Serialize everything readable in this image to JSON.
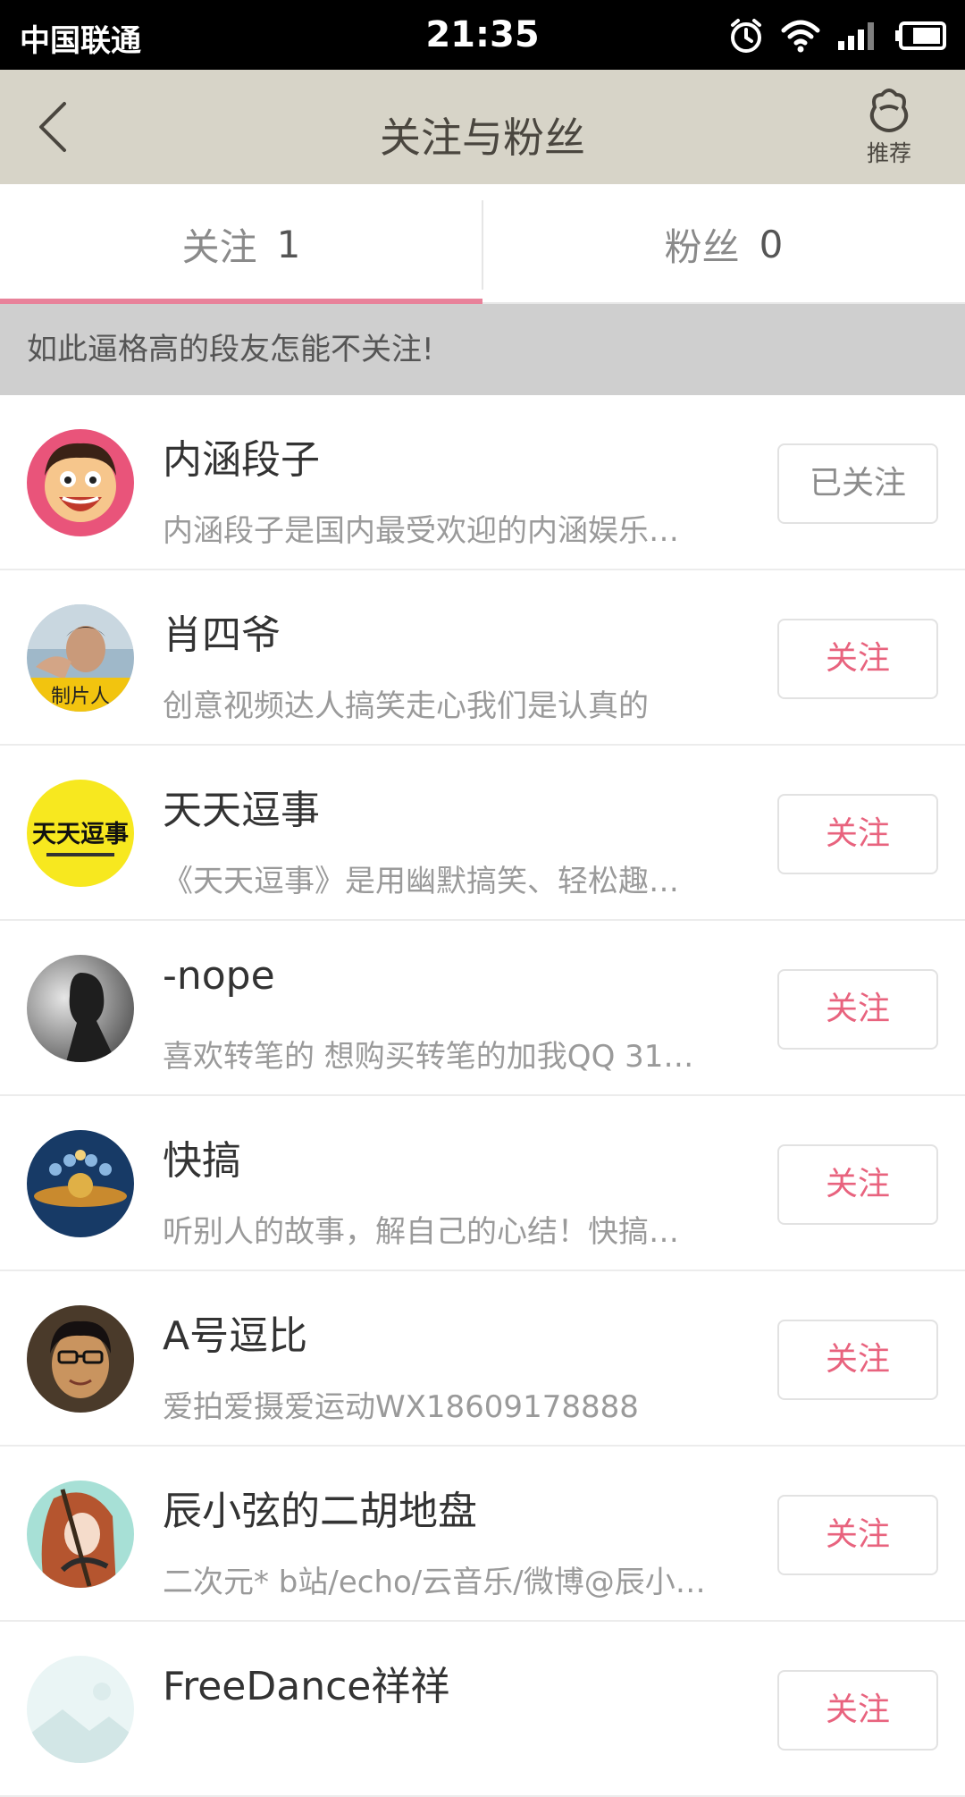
{
  "status_bar": {
    "carrier": "中国联通",
    "time": "21:35"
  },
  "header": {
    "title": "关注与粉丝",
    "recommend_label": "推荐"
  },
  "tabs": [
    {
      "label": "关注",
      "count": "1",
      "active": true
    },
    {
      "label": "粉丝",
      "count": "0",
      "active": false
    }
  ],
  "banner": "如此逼格高的段友怎能不关注!",
  "users": [
    {
      "name": "内涵段子",
      "desc": "内涵段子是国内最受欢迎的内涵娱乐…",
      "button": "已关注",
      "followed": true,
      "avatar": "cartoon-face"
    },
    {
      "name": "肖四爷",
      "desc": "创意视频达人搞笑走心我们是认真的",
      "button": "关注",
      "followed": false,
      "avatar": "person-photo",
      "avatar_badge": "制片人"
    },
    {
      "name": "天天逗事",
      "desc": "《天天逗事》是用幽默搞笑、轻松趣…",
      "button": "关注",
      "followed": false,
      "avatar": "yellow-logo",
      "avatar_text": "天天逗事"
    },
    {
      "name": "-nope",
      "desc": "喜欢转笔的 想购买转笔的加我QQ 31…",
      "button": "关注",
      "followed": false,
      "avatar": "silhouette"
    },
    {
      "name": "快搞",
      "desc": "听别人的故事，解自己的心结！快搞…",
      "button": "关注",
      "followed": false,
      "avatar": "blue-emblem"
    },
    {
      "name": "A号逗比",
      "desc": "爱拍爱摄爱运动WX18609178888",
      "button": "关注",
      "followed": false,
      "avatar": "glasses-photo"
    },
    {
      "name": "辰小弦的二胡地盘",
      "desc": "二次元* b站/echo/云音乐/微博@辰小…",
      "button": "关注",
      "followed": false,
      "avatar": "anime-art"
    },
    {
      "name": "FreeDance祥祥",
      "desc": "",
      "button": "关注",
      "followed": false,
      "avatar": "light-landscape"
    }
  ],
  "colors": {
    "accent": "#e8637e",
    "header_bg": "#d7d4c8",
    "banner_bg": "#cfcfcf"
  }
}
